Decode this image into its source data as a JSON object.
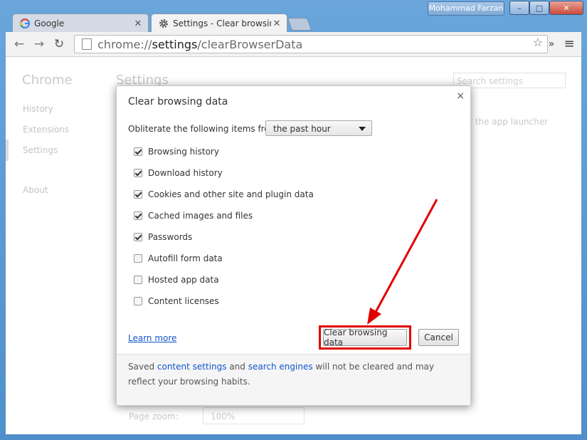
{
  "window": {
    "user_name": "Mohammad Farzan",
    "minimize": "–",
    "maximize": "□",
    "close": "✕"
  },
  "tabs": [
    {
      "label": "Google",
      "icon": "google-g-icon"
    },
    {
      "label": "Settings - Clear browsing data",
      "icon": "gear-icon"
    }
  ],
  "toolbar": {
    "back": "←",
    "forward": "→",
    "reload": "↻",
    "url_scheme": "chrome://",
    "url_host": "settings",
    "url_path": "/clearBrowserData",
    "overflow": "»",
    "menu": "≡",
    "star": "☆"
  },
  "background": {
    "app_title": "Chrome",
    "page_title": "Settings",
    "nav": [
      "History",
      "Extensions",
      "Settings",
      "About"
    ],
    "search_placeholder": "Search settings",
    "partial_text": "r the app launcher",
    "page_zoom_label": "Page zoom:",
    "page_zoom_value": "100%"
  },
  "dialog": {
    "title": "Clear browsing data",
    "close": "×",
    "obliterate_label": "Obliterate the following items from:",
    "time_range": "the past hour",
    "options": [
      {
        "label": "Browsing history",
        "checked": true
      },
      {
        "label": "Download history",
        "checked": true
      },
      {
        "label": "Cookies and other site and plugin data",
        "checked": true
      },
      {
        "label": "Cached images and files",
        "checked": true
      },
      {
        "label": "Passwords",
        "checked": true
      },
      {
        "label": "Autofill form data",
        "checked": false
      },
      {
        "label": "Hosted app data",
        "checked": false
      },
      {
        "label": "Content licenses",
        "checked": false
      }
    ],
    "learn_more": "Learn more",
    "clear_button": "Clear browsing data",
    "cancel_button": "Cancel",
    "footer": {
      "prefix": "Saved ",
      "link1": "content settings",
      "middle": " and ",
      "link2": "search engines",
      "suffix": " will not be cleared and may reflect your browsing habits."
    }
  },
  "annotation": {
    "color": "#e00000"
  }
}
